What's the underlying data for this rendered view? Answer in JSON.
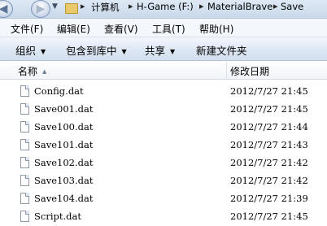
{
  "address": {
    "crumbs": [
      "计算机",
      "H-Game (F:)",
      "MaterialBrave",
      "Save"
    ]
  },
  "menu": [
    "文件(F)",
    "编辑(E)",
    "查看(V)",
    "工具(T)",
    "帮助(H)"
  ],
  "commands": {
    "organize": "组织",
    "include_in_library": "包含到库中",
    "share": "共享",
    "new_folder": "新建文件夹"
  },
  "columns": {
    "name": "名称",
    "modified": "修改日期"
  },
  "files": [
    {
      "name": "Config.dat",
      "modified": "2012/7/27 21:45"
    },
    {
      "name": "Save001.dat",
      "modified": "2012/7/27 21:45"
    },
    {
      "name": "Save100.dat",
      "modified": "2012/7/27 21:44"
    },
    {
      "name": "Save101.dat",
      "modified": "2012/7/27 21:43"
    },
    {
      "name": "Save102.dat",
      "modified": "2012/7/27 21:42"
    },
    {
      "name": "Save103.dat",
      "modified": "2012/7/27 21:42"
    },
    {
      "name": "Save104.dat",
      "modified": "2012/7/27 21:39"
    },
    {
      "name": "Script.dat",
      "modified": "2012/7/27 21:45"
    }
  ]
}
